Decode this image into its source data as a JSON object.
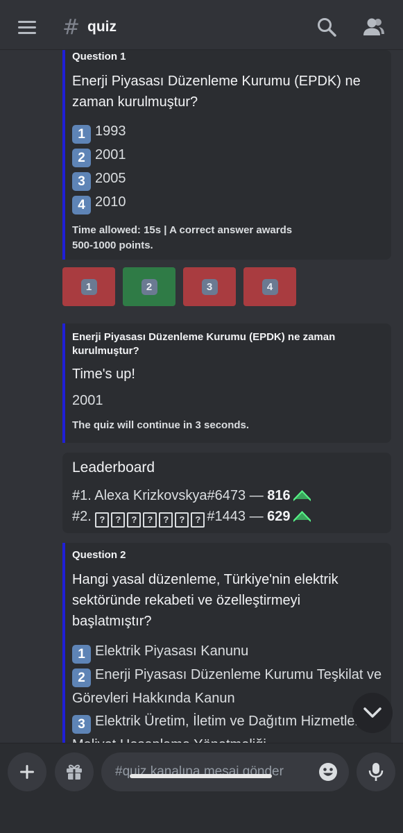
{
  "header": {
    "channel_name": "quiz",
    "hash_symbol": "#"
  },
  "question1": {
    "label": "Question 1",
    "title": "Enerji Piyasası Düzenleme Kurumu (EPDK) ne zaman kurulmuştur?",
    "options": [
      {
        "num": "1",
        "text": "1993"
      },
      {
        "num": "2",
        "text": "2001"
      },
      {
        "num": "3",
        "text": "2005"
      },
      {
        "num": "4",
        "text": "2010"
      }
    ],
    "footer": "Time allowed: 15s | A correct answer awards 500-1000 points."
  },
  "answer_buttons": [
    {
      "num": "1",
      "state": "wrong"
    },
    {
      "num": "2",
      "state": "correct"
    },
    {
      "num": "3",
      "state": "wrong"
    },
    {
      "num": "4",
      "state": "wrong"
    }
  ],
  "result": {
    "question": "Enerji Piyasası Düzenleme Kurumu (EPDK) ne zaman kurulmuştur?",
    "headline": "Time's up!",
    "answer": "2001",
    "continue_text": "The quiz will continue in 3 seconds."
  },
  "leaderboard": {
    "title": "Leaderboard",
    "rows": [
      {
        "rank": "#1.",
        "name": "Alexa Krizkovskya#6473",
        "sep": "—",
        "score": "816"
      },
      {
        "rank": "#2.",
        "name_suffix": "#1443",
        "sep": "—",
        "score": "629"
      }
    ]
  },
  "question2": {
    "label": "Question 2",
    "title": "Hangi yasal düzenleme, Türkiye'nin elektrik sektöründe rekabeti ve özelleştirmeyi başlatmıştır?",
    "options": [
      {
        "num": "1",
        "text": "Elektrik Piyasası Kanunu"
      },
      {
        "num": "2",
        "text": "Enerji Piyasası Düzenleme Kurumu Teşkilat ve Görevleri Hakkında Kanun"
      },
      {
        "num": "3",
        "text": "Elektrik Üretim, İletim ve Dağıtım Hizmetleri Maliyet Hesaplama Yönetmeliği"
      }
    ]
  },
  "composer": {
    "placeholder": "#quiz kanalına mesaj gönder"
  },
  "colors": {
    "embed_accent": "#1f1fd7",
    "wrong": "#a93c40",
    "correct": "#2f7b46",
    "trend_up": "#57f287"
  }
}
